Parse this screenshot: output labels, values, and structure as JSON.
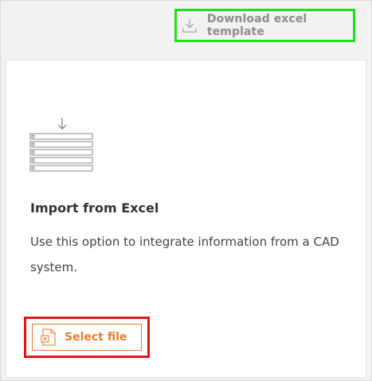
{
  "toolbar": {
    "download_template_label": "Download excel template"
  },
  "import_card": {
    "title": "Import from Excel",
    "description": "Use this option to integrate information from a CAD system.",
    "select_file_label": "Select file"
  },
  "icons": {
    "download": "download-icon",
    "excel_illustration": "spreadsheet-import-icon",
    "file": "excel-file-icon"
  },
  "colors": {
    "accent_orange": "#ef7c2f",
    "download_text": "#8c8c8c",
    "highlight_green": "#1fe01f",
    "highlight_red": "#e01515"
  }
}
